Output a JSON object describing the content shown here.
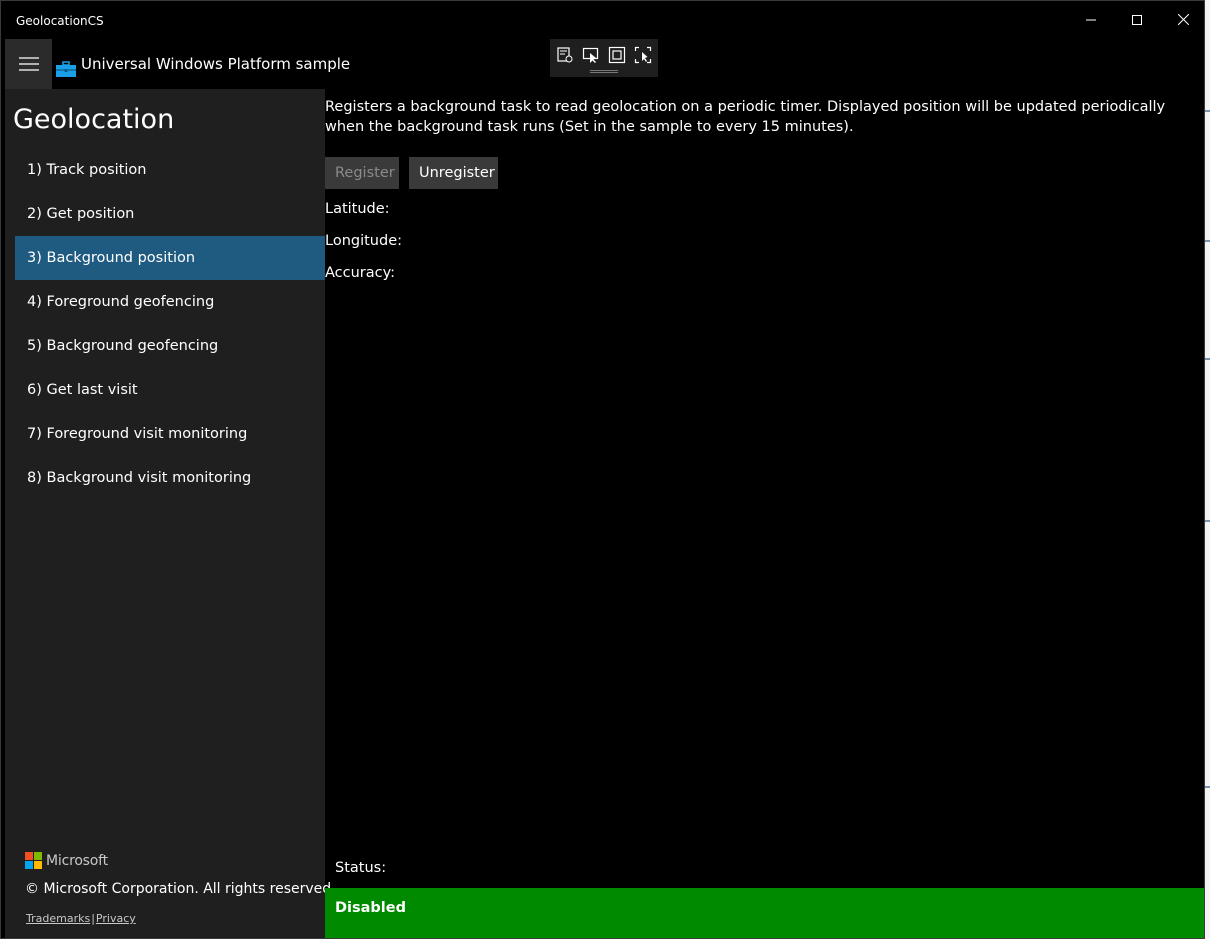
{
  "window": {
    "title": "GeolocationCS"
  },
  "header": {
    "app_title": "Universal Windows Platform sample"
  },
  "sidebar": {
    "title": "Geolocation",
    "items": [
      {
        "label": "1) Track position"
      },
      {
        "label": "2) Get position"
      },
      {
        "label": "3) Background position",
        "selected": true
      },
      {
        "label": "4) Foreground geofencing"
      },
      {
        "label": "5) Background geofencing"
      },
      {
        "label": "6) Get last visit"
      },
      {
        "label": "7) Foreground visit monitoring"
      },
      {
        "label": "8) Background visit monitoring"
      }
    ],
    "footer": {
      "brand": "Microsoft",
      "copyright": "© Microsoft Corporation. All rights reserved.",
      "trademarks": "Trademarks",
      "separator": "|",
      "privacy": "Privacy"
    }
  },
  "main": {
    "description": "Registers a background task to read geolocation on a periodic timer. Displayed position will be updated periodically when the background task runs (Set in the sample to every 15 minutes).",
    "register_label": "Register",
    "unregister_label": "Unregister",
    "latitude_label": "Latitude:",
    "longitude_label": "Longitude:",
    "accuracy_label": "Accuracy:"
  },
  "status": {
    "label": "Status:",
    "value": "Disabled",
    "color": "#008a00"
  },
  "colors": {
    "selected_nav": "#1f5a80",
    "sidebar_bg": "#1f1f1f",
    "content_bg": "#000000"
  }
}
